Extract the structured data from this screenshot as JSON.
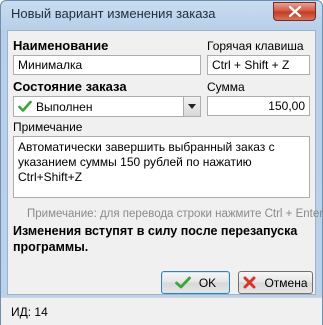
{
  "window": {
    "title": "Новый вариант изменения заказа"
  },
  "form": {
    "name_label": "Наименование",
    "name_value": "Минималка",
    "hotkey_label": "Горячая клавиша",
    "hotkey_value": "Ctrl + Shift + Z",
    "state_label": "Состояние заказа",
    "state_value": "Выполнен",
    "sum_label": "Сумма",
    "sum_value": "150,00",
    "note_label": "Примечание",
    "note_value": "Автоматически завершить выбранный заказ с указанием суммы 150 рублей по нажатию Ctrl+Shift+Z",
    "note_hint": "Примечание: для перевода строки нажмите Ctrl + Enter.",
    "restart_notice": "Изменения вступят в силу после перезапуска программы."
  },
  "buttons": {
    "ok_label": "OK",
    "cancel_label": "Отмена"
  },
  "status": {
    "id_text": "ИД: 14"
  },
  "colors": {
    "check_green": "#3aa53a",
    "cancel_red": "#d9342b"
  }
}
